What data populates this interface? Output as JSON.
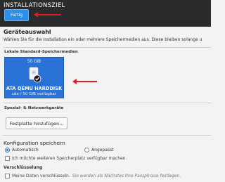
{
  "header": {
    "title": "INSTALLATIONSZIEL",
    "done_label": "Fertig"
  },
  "device_selection": {
    "title": "Geräteauswahl",
    "description": "Wählen Sie für die Installation ein oder mehrere Speichermedien aus. Diese bleiben solange u"
  },
  "local_disks": {
    "label": "Lokale Standard-Speichermedien",
    "disks": [
      {
        "size": "50 GiB",
        "name": "ATA QEMU HARDDISK",
        "detail": "sda / 50 GiB verfügbar",
        "selected": true
      }
    ]
  },
  "network_disks": {
    "label": "Spezial- & Netzwerkgeräte",
    "add_label": "Festplatte hinzufügen..."
  },
  "storage_config": {
    "title": "Konfiguration speichern",
    "options": [
      {
        "label": "Automatisch",
        "checked": true
      },
      {
        "label": "Angepasst",
        "checked": false
      }
    ],
    "make_space_label": "Ich möchte weiteren Speicherplatz verfügbar machen."
  },
  "encryption": {
    "label": "Verschlüsselung",
    "encrypt_label": "Meine Daten verschlüsseln.",
    "hint": "Sie werden als Nächstes Ihre Passphrase festlegen."
  },
  "colors": {
    "header_bg": "#2a2b2d",
    "accent": "#2b72d6",
    "arrow": "#e01b24"
  }
}
